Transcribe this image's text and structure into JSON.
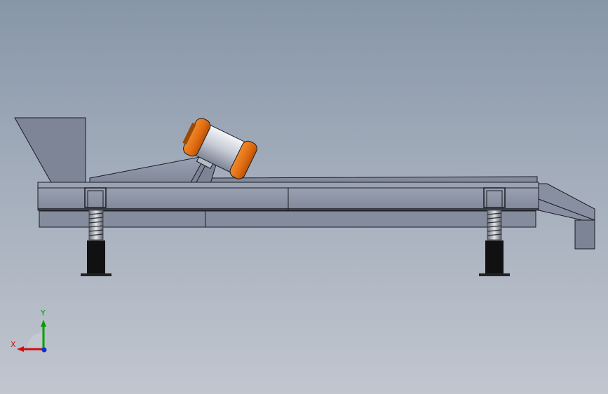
{
  "viewport": {
    "background_top": "#8796a8",
    "background_bottom": "#c1c6cf"
  },
  "model": {
    "frame_color": "#8a92a3",
    "edge_color": "#1a1c22",
    "motor_end_color": "#e87212",
    "motor_body_color": "#c9ced9",
    "support_color": "#111111"
  },
  "triad": {
    "x_label": "X",
    "y_label": "Y",
    "x_color": "#d01010",
    "y_color": "#00a000",
    "z_color": "#1030d0"
  }
}
